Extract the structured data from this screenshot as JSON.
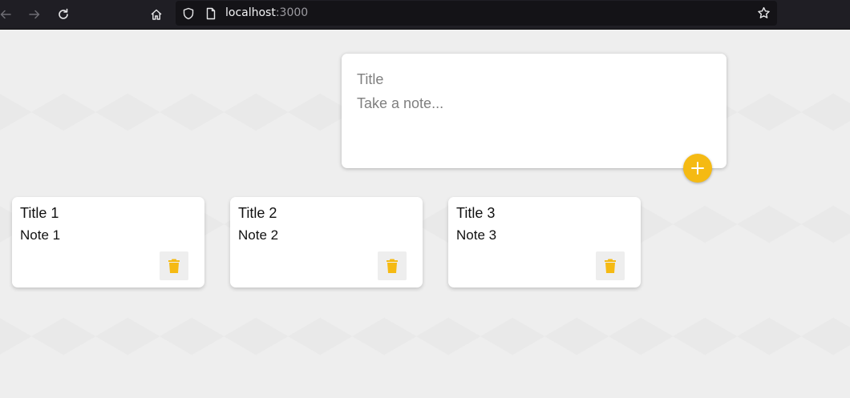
{
  "browser": {
    "url_host": "localhost",
    "url_port": ":3000",
    "icons": [
      "back-arrow-icon",
      "forward-arrow-icon",
      "reload-icon",
      "home-icon",
      "shield-icon",
      "page-icon",
      "star-icon"
    ]
  },
  "create_note": {
    "title_placeholder": "Title",
    "content_placeholder": "Take a note...",
    "add_icon": "plus-icon"
  },
  "notes": [
    {
      "title": "Title 1",
      "content": "Note 1"
    },
    {
      "title": "Title 2",
      "content": "Note 2"
    },
    {
      "title": "Title 3",
      "content": "Note 3"
    }
  ],
  "colors": {
    "accent": "#f5ba13",
    "background": "#eeeeee",
    "card": "#ffffff",
    "toolbar": "#1f1e24"
  }
}
